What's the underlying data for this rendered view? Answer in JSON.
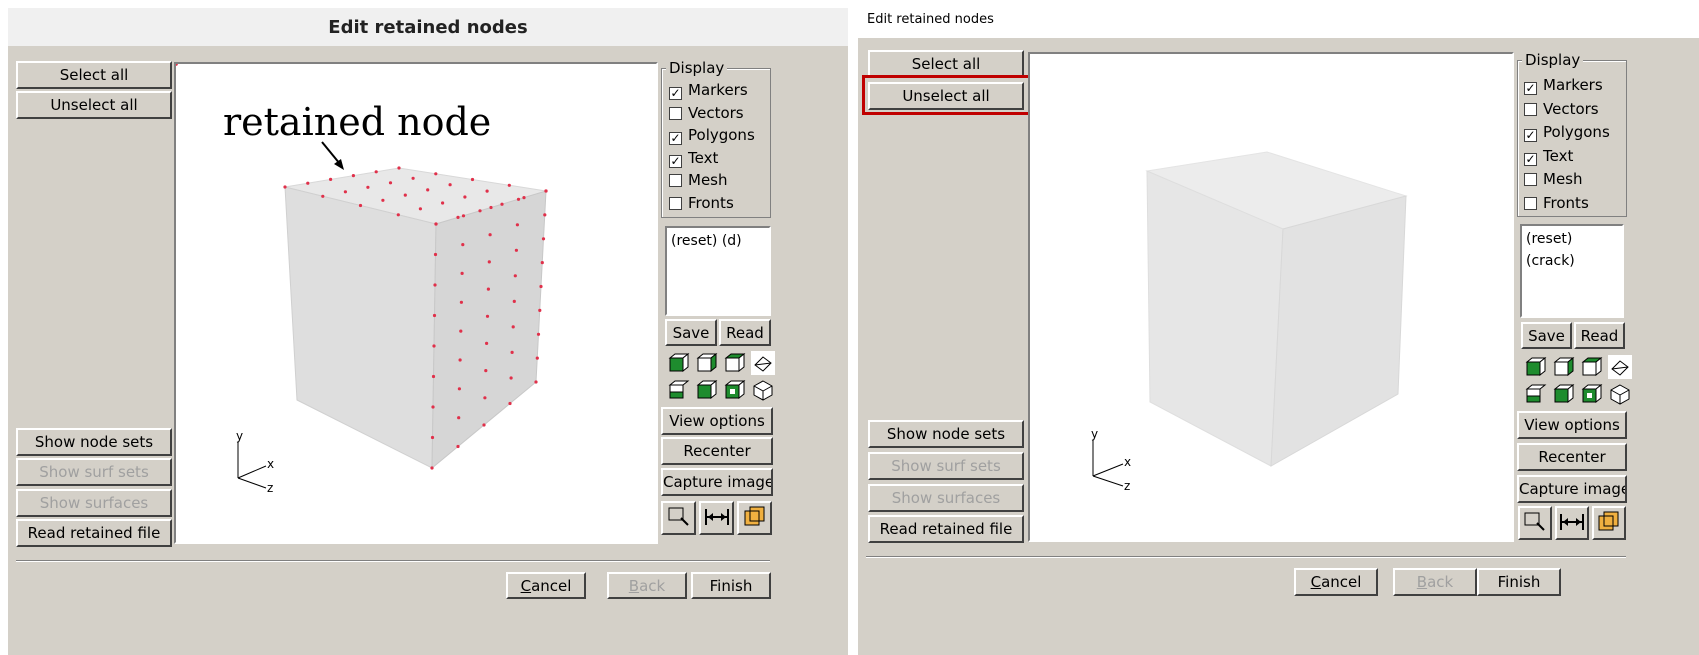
{
  "left": {
    "title": "Edit retained nodes",
    "buttons": {
      "select_all": "Select all",
      "unselect_all": "Unselect all",
      "show_node_sets": "Show node sets",
      "show_surf_sets": "Show surf sets",
      "show_surfaces": "Show surfaces",
      "read_retained_file": "Read retained file"
    },
    "display": {
      "legend": "Display",
      "options": [
        {
          "label": "Markers",
          "checked": true
        },
        {
          "label": "Vectors",
          "checked": false
        },
        {
          "label": "Polygons",
          "checked": true
        },
        {
          "label": "Text",
          "checked": true
        },
        {
          "label": "Mesh",
          "checked": false
        },
        {
          "label": "Fronts",
          "checked": false
        }
      ]
    },
    "list_items": [
      "(reset) (d)"
    ],
    "save": "Save",
    "read": "Read",
    "view_options": "View options",
    "recenter": "Recenter",
    "capture_image": "Capture image",
    "annotation": "retained node",
    "axes": {
      "y": "y",
      "x": "x",
      "z": "z"
    },
    "footer": {
      "cancel_u": "C",
      "cancel_rest": "ancel",
      "back_u": "B",
      "back_rest": "ack",
      "finish": "Finish"
    }
  },
  "right": {
    "title": "Edit retained nodes",
    "buttons": {
      "select_all": "Select all",
      "unselect_all": "Unselect all",
      "show_node_sets": "Show node sets",
      "show_surf_sets": "Show surf sets",
      "show_surfaces": "Show surfaces",
      "read_retained_file": "Read retained file"
    },
    "display": {
      "legend": "Display",
      "options": [
        {
          "label": "Markers",
          "checked": true
        },
        {
          "label": "Vectors",
          "checked": false
        },
        {
          "label": "Polygons",
          "checked": true
        },
        {
          "label": "Text",
          "checked": true
        },
        {
          "label": "Mesh",
          "checked": false
        },
        {
          "label": "Fronts",
          "checked": false
        }
      ]
    },
    "list_items": [
      "(reset)",
      "(crack)"
    ],
    "save": "Save",
    "read": "Read",
    "view_options": "View options",
    "recenter": "Recenter",
    "capture_image": "Capture image",
    "axes": {
      "y": "y",
      "x": "x",
      "z": "z"
    },
    "footer": {
      "cancel_u": "C",
      "cancel_rest": "ancel",
      "back_u": "B",
      "back_rest": "ack",
      "finish": "Finish"
    }
  },
  "colors": {
    "panel_bg": "#d4d0c8",
    "marker": "#e0304a",
    "highlight_box": "#c00000",
    "icon_green": "#1e8c2e",
    "icon_orange": "#f0b040"
  }
}
